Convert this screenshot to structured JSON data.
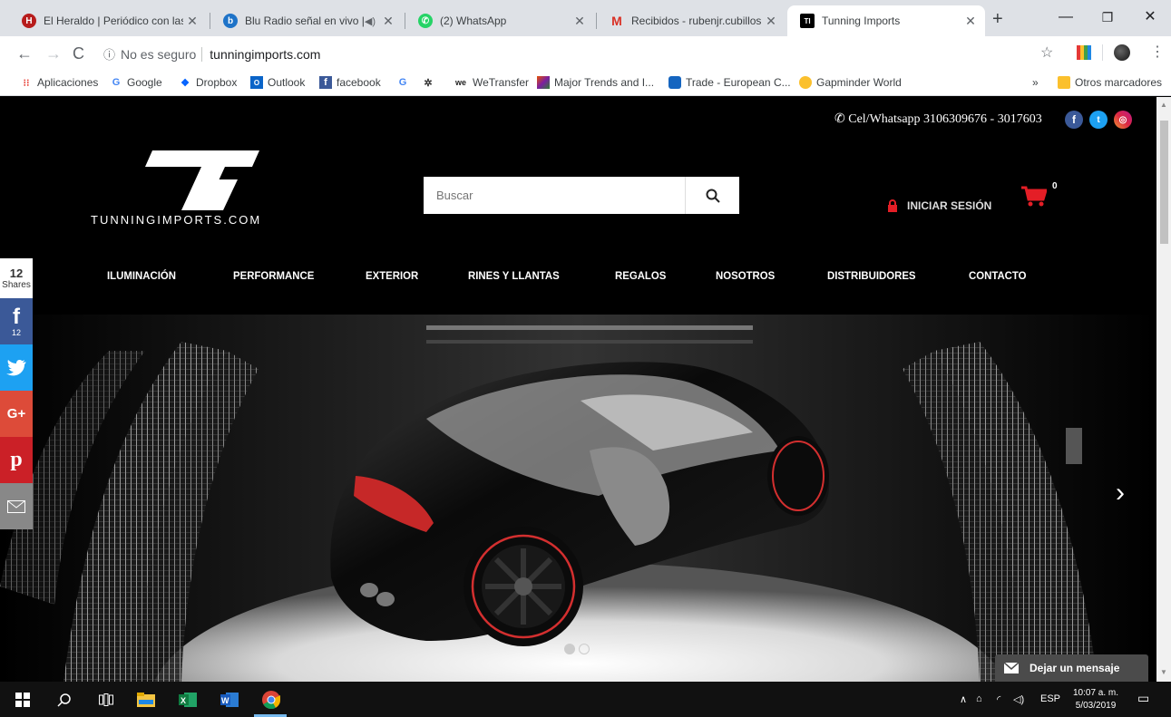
{
  "browser": {
    "tabs": [
      {
        "title": "El Heraldo | Periódico con las ú",
        "favicon_color": "#b71c1c",
        "favicon_letter": "H"
      },
      {
        "title": "Blu Radio señal en vivo | N",
        "favicon_color": "#1e73c8",
        "favicon_letter": "b"
      },
      {
        "title": "(2) WhatsApp",
        "favicon_color": "#25d366",
        "favicon_letter": "✆"
      },
      {
        "title": "Recibidos - rubenjr.cubillos@",
        "favicon_color": "#ffffff",
        "favicon_letter": "M"
      },
      {
        "title": "Tunning Imports",
        "favicon_color": "#000000",
        "favicon_letter": "TI"
      }
    ],
    "new_tab": "+",
    "address": {
      "security": "No es seguro",
      "url": "tunningimports.com"
    },
    "bookmarks": [
      {
        "label": "Aplicaciones",
        "icon": "apps-icon",
        "color": "#e8453c"
      },
      {
        "label": "Google",
        "icon": "google-icon",
        "color": "#4285f4"
      },
      {
        "label": "Dropbox",
        "icon": "dropbox-icon",
        "color": "#0061ff"
      },
      {
        "label": "Outlook",
        "icon": "outlook-icon",
        "color": "#0a64c8"
      },
      {
        "label": "facebook",
        "icon": "facebook-icon",
        "color": "#3b5998"
      },
      {
        "label": "",
        "icon": "google-icon",
        "color": "#4285f4"
      },
      {
        "label": "",
        "icon": "sena-icon",
        "color": "#333333"
      },
      {
        "label": "WeTransfer",
        "icon": "wetransfer-icon",
        "color": "#222222"
      },
      {
        "label": "Major Trends and I...",
        "icon": "trends-icon",
        "color": "#e65100"
      },
      {
        "label": "Trade - European C...",
        "icon": "eu-icon",
        "color": "#1565c0"
      },
      {
        "label": "Gapminder World",
        "icon": "gapminder-icon",
        "color": "#fbc02d"
      }
    ],
    "bookmarks_more": "»",
    "other_bookmarks": "Otros marcadores"
  },
  "site": {
    "contact": "Cel/Whatsapp 3106309676 - 3017603",
    "logo_text": "TUNNINGIMPORTS.COM",
    "search_placeholder": "Buscar",
    "login": "INICIAR SESIÓN",
    "cart_count": "0",
    "nav": [
      "ILUMINACIÓN",
      "PERFORMANCE",
      "EXTERIOR",
      "RINES Y LLANTAS",
      "REGALOS",
      "NOSOTROS",
      "DISTRIBUIDORES",
      "CONTACTO"
    ],
    "share_count": "12",
    "share_label": "Shares",
    "facebook_count": "12",
    "chat_label": "Dejar un mensaje",
    "slider_active": 1,
    "slider_total": 2
  },
  "taskbar": {
    "language": "ESP",
    "time": "10:07 a. m.",
    "date": "5/03/2019"
  }
}
